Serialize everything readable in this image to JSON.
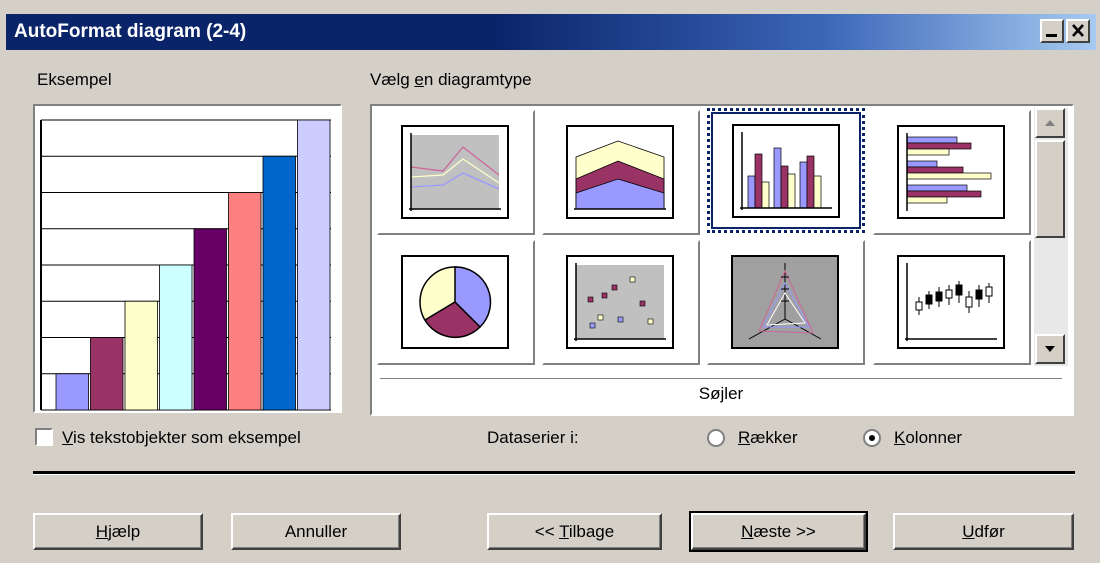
{
  "window": {
    "title": "AutoFormat diagram  (2-4)",
    "controls": [
      "minimize-icon",
      "close-icon"
    ]
  },
  "example": {
    "label": "Eksempel",
    "chart_data": {
      "type": "bar",
      "values": [
        1,
        2,
        3,
        4,
        5,
        6,
        7,
        8
      ],
      "colors": [
        "#9999ff",
        "#993366",
        "#ffffcc",
        "#ccffff",
        "#660066",
        "#ff8080",
        "#0066cc",
        "#ccccff"
      ],
      "ylim": [
        0,
        8
      ],
      "grid": true
    },
    "show_text_checkbox": {
      "pre": "",
      "accel": "V",
      "post": "is tekstobjekter som eksempel",
      "checked": false
    }
  },
  "gallery": {
    "label_pre": "Vælg ",
    "label_accel": "e",
    "label_post": "n diagramtype",
    "items": [
      {
        "icon": "line-chart-icon",
        "selected": false
      },
      {
        "icon": "area-chart-icon",
        "selected": false
      },
      {
        "icon": "column-chart-icon",
        "selected": true
      },
      {
        "icon": "bar-chart-icon",
        "selected": false
      },
      {
        "icon": "pie-chart-icon",
        "selected": false
      },
      {
        "icon": "xy-scatter-chart-icon",
        "selected": false
      },
      {
        "icon": "net-chart-icon",
        "selected": false
      },
      {
        "icon": "stock-chart-icon",
        "selected": false
      }
    ],
    "selected_type_name": "Søjler"
  },
  "data_series": {
    "label": "Dataserier i:",
    "rows": {
      "accel": "R",
      "rest": "ækker",
      "selected": false
    },
    "columns": {
      "accel": "K",
      "rest": "olonner",
      "selected": true
    }
  },
  "buttons": {
    "help": {
      "accel": "H",
      "rest": "jælp"
    },
    "cancel": {
      "label": "Annuller"
    },
    "back": {
      "pre": "<< ",
      "accel": "T",
      "rest": "ilbage"
    },
    "next": {
      "accel": "N",
      "rest": "æste >>"
    },
    "finish": {
      "accel": "U",
      "rest": "dfør"
    }
  }
}
